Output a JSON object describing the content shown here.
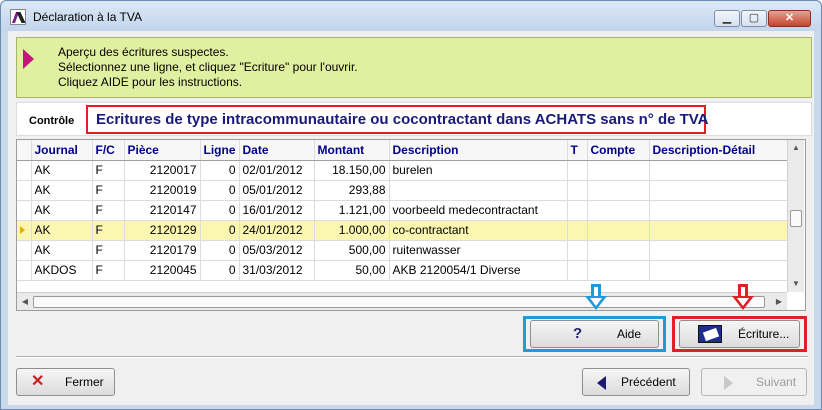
{
  "window": {
    "title": "Déclaration à la TVA",
    "controls": {
      "minimize": "▁",
      "maximize": "▢",
      "close": "✕"
    }
  },
  "instructions": [
    "Aperçu des écritures suspectes.",
    "Sélectionnez une ligne, et cliquez \"Ecriture\" pour l'ouvrir.",
    "Cliquez AIDE pour les instructions."
  ],
  "control": {
    "label": "Contrôle",
    "value": "Ecritures de type intracommunautaire ou cocontractant dans ACHATS sans n° de TVA"
  },
  "table": {
    "columns": [
      "Journal",
      "F/C",
      "Pièce",
      "Ligne",
      "Date",
      "Montant",
      "Description",
      "T",
      "Compte",
      "Description-Détail"
    ],
    "rows": [
      [
        "AK",
        "F",
        "2120017",
        "0",
        "02/01/2012",
        "18.150,00",
        "burelen",
        "",
        "",
        ""
      ],
      [
        "AK",
        "F",
        "2120019",
        "0",
        "05/01/2012",
        "293,88",
        "",
        "",
        "",
        ""
      ],
      [
        "AK",
        "F",
        "2120147",
        "0",
        "16/01/2012",
        "1.121,00",
        "voorbeeld medecontractant",
        "",
        "",
        ""
      ],
      [
        "AK",
        "F",
        "2120129",
        "0",
        "24/01/2012",
        "1.000,00",
        "co-contractant",
        "",
        "",
        ""
      ],
      [
        "AK",
        "F",
        "2120179",
        "0",
        "05/03/2012",
        "500,00",
        "ruitenwasser",
        "",
        "",
        ""
      ],
      [
        "AKDOS",
        "F",
        "2120045",
        "0",
        "31/03/2012",
        "50,00",
        "AKB 2120054/1 Diverse",
        "",
        "",
        ""
      ]
    ],
    "selected_row": 3
  },
  "buttons": {
    "aide": "Aide",
    "ecriture": "Écriture...",
    "fermer": "Fermer",
    "precedent": "Précédent",
    "suivant": "Suivant"
  },
  "colors": {
    "instruction_bg": "#e1f0a0",
    "highlight_red": "#e02025",
    "highlight_blue": "#1f9bd6",
    "selected_row": "#fbf7b0"
  }
}
